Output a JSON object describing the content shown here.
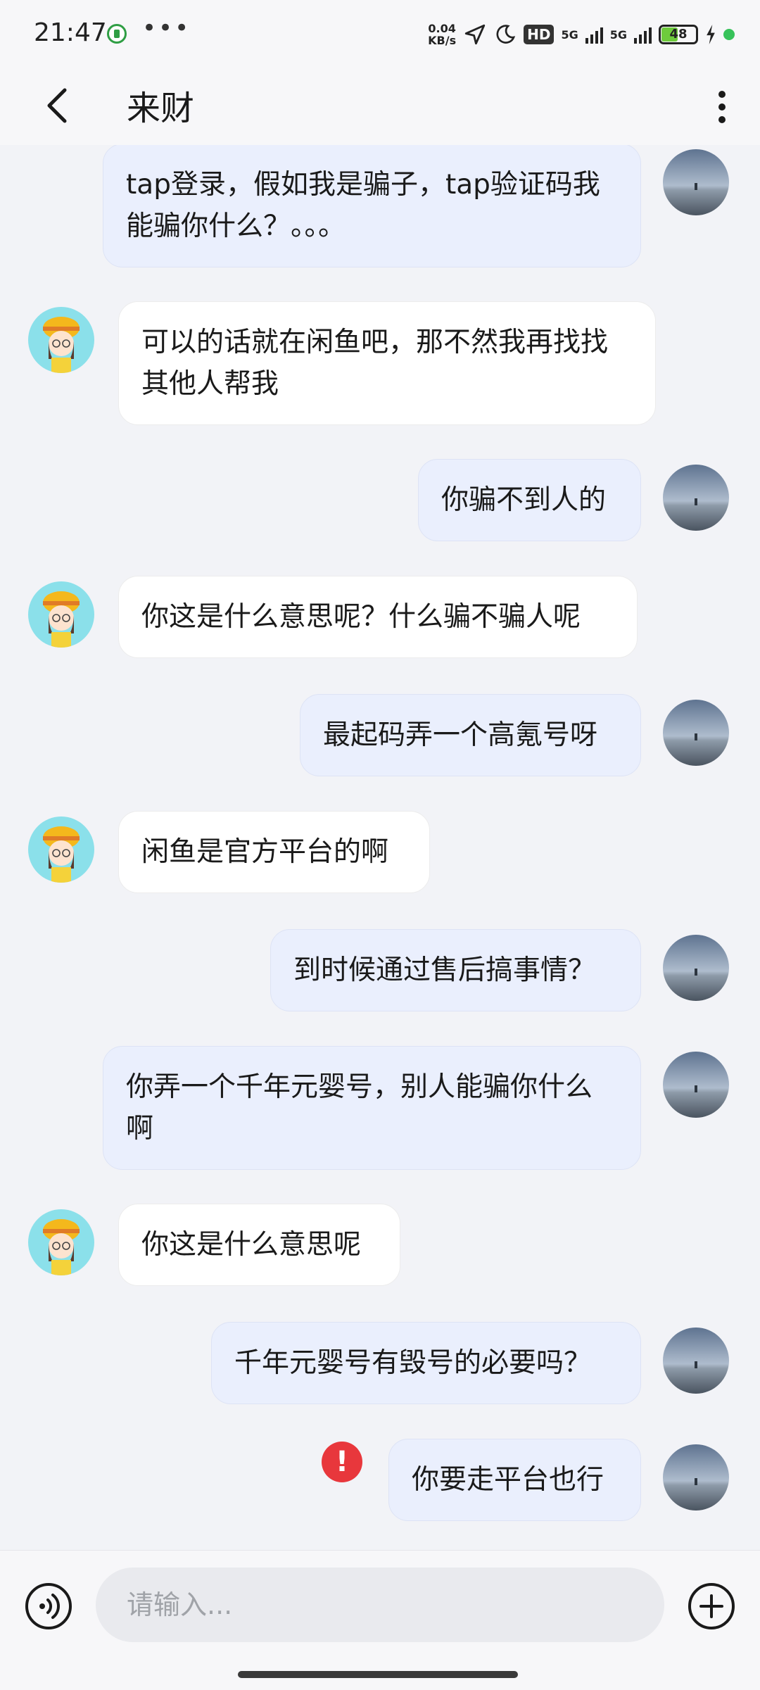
{
  "status_bar": {
    "time": "21:47",
    "more": "•••",
    "speed_value": "0.04",
    "speed_unit": "KB/s",
    "hd_label": "HD",
    "sim1": "5G",
    "sim2": "5G",
    "battery": "48",
    "battery_level_percent": 48
  },
  "header": {
    "title": "来财"
  },
  "messages": [
    {
      "from": "me",
      "text": "tap登录，假如我是骗子，tap验证码我能骗你什么？。。。"
    },
    {
      "from": "them",
      "text": "可以的话就在闲鱼吧，那不然我再找找其他人帮我"
    },
    {
      "from": "me",
      "text": "你骗不到人的"
    },
    {
      "from": "them",
      "text": "你这是什么意思呢？什么骗不骗人呢"
    },
    {
      "from": "me",
      "text": "最起码弄一个高氪号呀"
    },
    {
      "from": "them",
      "text": "闲鱼是官方平台的啊"
    },
    {
      "from": "me",
      "text": "到时候通过售后搞事情？"
    },
    {
      "from": "me",
      "text": "你弄一个千年元婴号，别人能骗你什么啊"
    },
    {
      "from": "them",
      "text": "你这是什么意思呢"
    },
    {
      "from": "me",
      "text": "千年元婴号有毁号的必要吗？"
    },
    {
      "from": "me",
      "text": "你要走平台也行",
      "status": "failed",
      "status_icon": "!"
    }
  ],
  "input": {
    "placeholder": "请输入..."
  },
  "colors": {
    "my_bubble": "#eaeffd",
    "their_bubble": "#ffffff",
    "error": "#e8373c",
    "background": "#f2f3f7"
  }
}
